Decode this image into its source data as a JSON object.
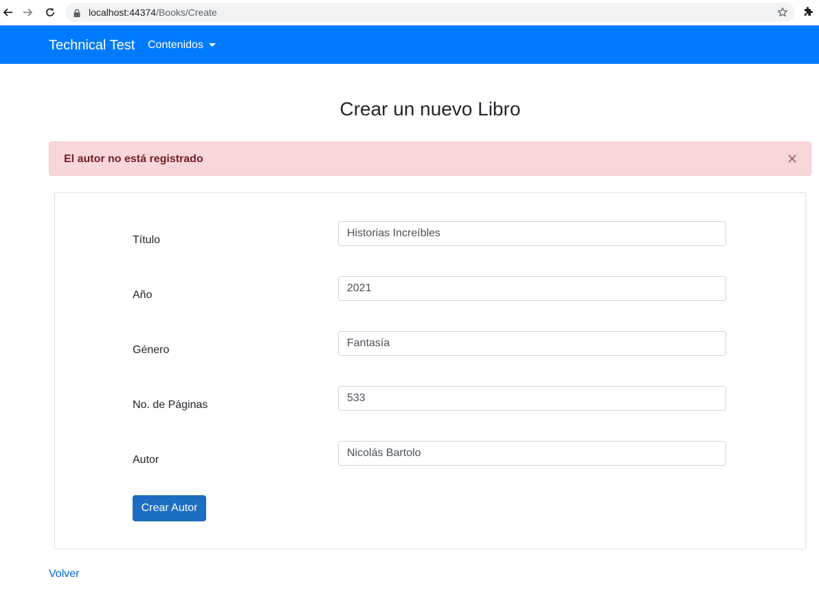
{
  "browser": {
    "url_host": "localhost:44374",
    "url_path": "/Books/Create"
  },
  "navbar": {
    "brand": "Technical Test",
    "menu_label": "Contenidos"
  },
  "page": {
    "title": "Crear un nuevo Libro",
    "alert_message": "El autor no está registrado",
    "back_link": "Volver"
  },
  "form": {
    "fields": [
      {
        "label": "Título",
        "value": "Historias Increíbles"
      },
      {
        "label": "Año",
        "value": "2021"
      },
      {
        "label": "Género",
        "value": "Fantasía"
      },
      {
        "label": "No. de Páginas",
        "value": "533"
      },
      {
        "label": "Autor",
        "value": "Nicolás Bartolo"
      }
    ],
    "submit_label": "Crear Autor"
  },
  "icons": {
    "back": "back-arrow-icon",
    "forward": "forward-arrow-icon",
    "reload": "reload-icon",
    "lock": "lock-icon",
    "bookmark": "star-icon",
    "extensions": "puzzle-icon",
    "dropdown": "caret-down-icon",
    "close": "close-icon"
  },
  "colors": {
    "navbar": "#007bff",
    "alert_bg": "#f8d7da",
    "alert_text": "#721c24",
    "button": "#1b6ec2",
    "link": "#0366d6"
  }
}
